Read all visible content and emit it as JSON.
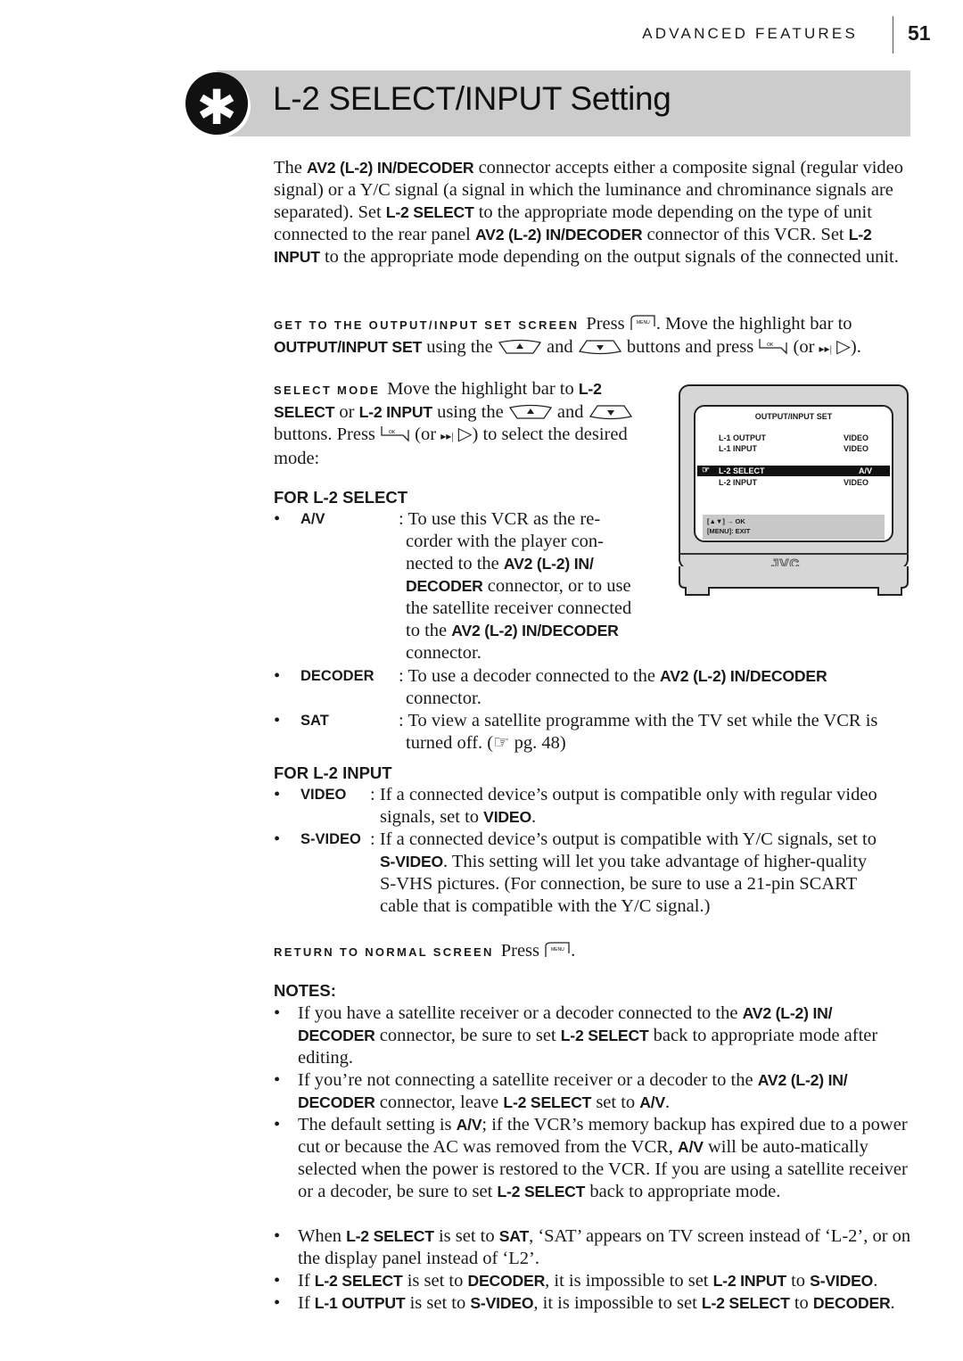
{
  "header": {
    "section": "ADVANCED FEATURES",
    "page_number": "51"
  },
  "title": {
    "icon": "asterisk-icon",
    "text": "L-2 SELECT/INPUT Setting"
  },
  "intro": {
    "t1": "The ",
    "k1": "AV2 (L-2) IN/DECODER",
    "t2": " connector accepts either a composite signal (regular video signal) or a Y/C signal (a signal in which the luminance and chrominance signals are separated). Set ",
    "k2": "L-2 SELECT",
    "t3": " to the appropriate mode depending on the type of unit connected to the rear panel ",
    "k3": "AV2 (L-2) IN/DECODER",
    "t4": " connector of this VCR. Set ",
    "k4": "L-2 INPUT",
    "t5": " to the appropriate mode depending on the output signals of the connected unit."
  },
  "step_get": {
    "lead": "GET TO THE OUTPUT/INPUT SET SCREEN",
    "t1": "Press ",
    "t2": ". Move the highlight bar to ",
    "k1": "OUTPUT/INPUT SET",
    "t3": " using the ",
    "t4": " and ",
    "t5": " buttons and press ",
    "t6": " (or ",
    "t7": " ▷)."
  },
  "step_select": {
    "lead": "SELECT MODE",
    "t1": "Move the highlight bar to ",
    "k1": "L-2 SELECT",
    "t2": " or ",
    "k2": "L-2 INPUT",
    "t3": " using the ",
    "t4": " and ",
    "t5": " buttons. Press ",
    "t6": " (or ",
    "t7": " ▷) to select the desired mode:"
  },
  "for_select": {
    "heading": "FOR L-2 SELECT",
    "options": [
      {
        "term": "A/V",
        "d1": ": To use this VCR as the re-",
        "d2": "corder with the player con-",
        "d3a": "nected to the ",
        "d3k": "AV2 (L-2) IN/",
        "d4k": "DECODER",
        "d4a": " connector, or to use",
        "d5": "the satellite receiver connected",
        "d6a": "to the ",
        "d6k": "AV2 (L-2) IN/DECODER",
        "d7": "connector."
      },
      {
        "term": "DECODER",
        "d1a": ": To use a decoder connected to the ",
        "d1k": "AV2 (L-2) IN/DECODER",
        "d2": "connector."
      },
      {
        "term": "SAT",
        "d1": ": To view a satellite programme with the TV set while the VCR is",
        "d2": "turned off. (☞ pg. 48)"
      }
    ]
  },
  "for_input": {
    "heading": "FOR L-2 INPUT",
    "options": [
      {
        "term": "VIDEO",
        "d1": ": If a connected device’s output is compatible only with regular video",
        "d2a": "signals, set to ",
        "d2k": "VIDEO",
        "d2b": "."
      },
      {
        "term": "S-VIDEO",
        "d1": ": If a connected device’s output is compatible with Y/C signals, set to",
        "d2k": "S-VIDEO",
        "d2b": ". This setting will let you take advantage of higher-quality",
        "d3": "S-VHS pictures. (For connection, be sure to use a 21-pin SCART",
        "d4": "cable that is compatible with the Y/C signal.)"
      }
    ]
  },
  "step_return": {
    "lead": "RETURN TO NORMAL SCREEN",
    "t1": "Press ",
    "t2": "."
  },
  "notes": {
    "heading": "NOTES:",
    "n1": {
      "a": "If you have a satellite receiver or a decoder connected to the ",
      "k1": "AV2 (L-2) IN/",
      "k2": "DECODER",
      "b": " connector, be sure to set ",
      "k3": "L-2 SELECT",
      "c": " back to appropriate mode after editing."
    },
    "n2": {
      "a": "If you’re not connecting a satellite receiver or a decoder to the ",
      "k1": "AV2 (L-2) IN/",
      "k2": "DECODER",
      "b": " connector, leave ",
      "k3": "L-2 SELECT",
      "c": " set to ",
      "k4": "A/V",
      "d": "."
    },
    "n3": {
      "a": "The default setting is ",
      "k1": "A/V",
      "b": "; if the VCR’s memory backup has expired due to a power cut or because the AC was removed from the VCR, ",
      "k2": "A/V",
      "c": " will be auto-matically selected when the power is restored to the VCR. If you are using a satellite receiver or a decoder, be sure to set ",
      "k3": "L-2 SELECT",
      "d": " back to appropriate mode."
    },
    "n4": {
      "a": "When ",
      "k1": "L-2 SELECT",
      "b": " is set to ",
      "k2": "SAT",
      "c": ", ‘SAT’ appears on TV screen instead of ‘L-2’, or on the display panel instead of ‘L2’."
    },
    "n5": {
      "a": "If ",
      "k1": "L-2 SELECT",
      "b": " is set to ",
      "k2": "DECODER",
      "c": ", it is impossible to set ",
      "k3": "L-2 INPUT",
      "d": " to ",
      "k4": "S-VIDEO",
      "e": "."
    },
    "n6": {
      "a": "If ",
      "k1": "L-1 OUTPUT",
      "b": " is set to ",
      "k2": "S-VIDEO",
      "c": ", it is impossible to set ",
      "k3": "L-2 SELECT",
      "d": " to ",
      "k4": "DECODER",
      "e": "."
    }
  },
  "tv_screen": {
    "title": "OUTPUT/INPUT SET",
    "rows": [
      {
        "label": "L-1 OUTPUT",
        "value": "VIDEO"
      },
      {
        "label": "L-1 INPUT",
        "value": "VIDEO"
      },
      {
        "label": "L-2 SELECT",
        "value": "A/V",
        "selected": true
      },
      {
        "label": "L-2 INPUT",
        "value": "VIDEO"
      }
    ],
    "help1": "[▲▼] → OK",
    "help2": "[MENU]: EXIT",
    "brand": "JVC"
  },
  "icons": {
    "menu_button": "menu-button-icon",
    "up_button": "up-button-icon",
    "down_button": "down-button-icon",
    "ok_button": "ok-button-icon",
    "skip_button": "skip-forward-icon",
    "pointer": "pointing-hand-icon"
  },
  "colors": {
    "title_bar": "#cccccc",
    "text": "#1a1a1a",
    "osd_highlight": "#111111"
  }
}
